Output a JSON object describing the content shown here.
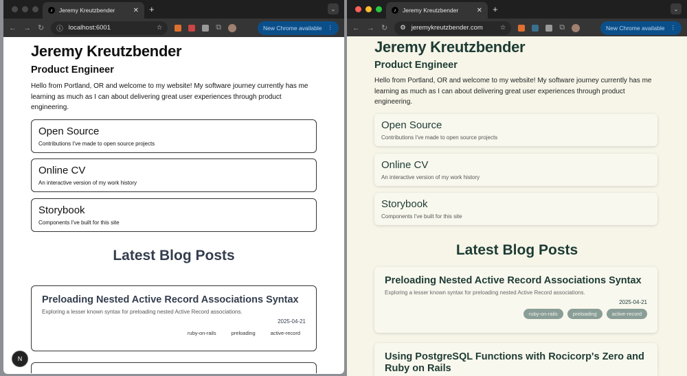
{
  "left": {
    "tab_title": "Jeremy Kreutzbender",
    "url": "localhost:6001",
    "update_label": "New Chrome available"
  },
  "right": {
    "tab_title": "Jeremy Kreutzbender",
    "url": "jeremykreutzbender.com",
    "update_label": "New Chrome available"
  },
  "site": {
    "name": "Jeremy Kreutzbender",
    "role": "Product Engineer",
    "intro": "Hello from Portland, OR and welcome to my website! My software journey currently has me learning as much as I can about delivering great user experiences through product engineering.",
    "cards": [
      {
        "title": "Open Source",
        "desc": "Contributions I've made to open source projects"
      },
      {
        "title": "Online CV",
        "desc": "An interactive version of my work history"
      },
      {
        "title": "Storybook",
        "desc": "Components I've built for this site"
      }
    ],
    "blog_heading": "Latest Blog Posts",
    "posts": [
      {
        "title": "Preloading Nested Active Record Associations Syntax",
        "desc": "Exploring a lesser known syntax for preloading nested Active Record associations.",
        "date": "2025-04-21",
        "tags": [
          "ruby-on-rails",
          "preloading",
          "active-record"
        ]
      },
      {
        "title": "Using PostgreSQL Functions with Rocicorp's Zero and Ruby on Rails"
      }
    ]
  },
  "nextjs_badge": "N",
  "colors": {
    "left_text": "#111111",
    "left_heading": "#333d4d",
    "right_text": "#1d3b34",
    "right_bg": "#f6f5e8"
  }
}
